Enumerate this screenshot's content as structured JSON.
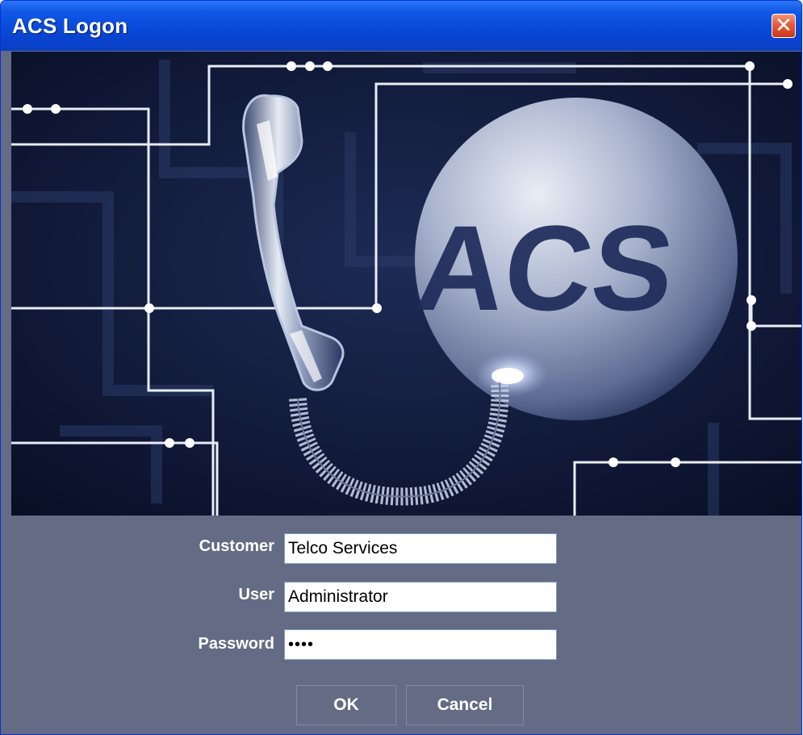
{
  "window": {
    "title": "ACS Logon",
    "close_glyph": "✕"
  },
  "banner": {
    "logo_text": "ACS",
    "icons": [
      "telephone-handset-icon",
      "globe-icon"
    ]
  },
  "form": {
    "customer": {
      "label": "Customer",
      "value": "Telco Services"
    },
    "user": {
      "label": "User",
      "value": "Administrator"
    },
    "password": {
      "label": "Password",
      "value": "••••"
    }
  },
  "buttons": {
    "ok": "OK",
    "cancel": "Cancel"
  },
  "colors": {
    "titlebar": "#0a4ad8",
    "panel": "#636b85",
    "banner_bg": "#0b1230",
    "circuit": "#e8ecf5"
  }
}
